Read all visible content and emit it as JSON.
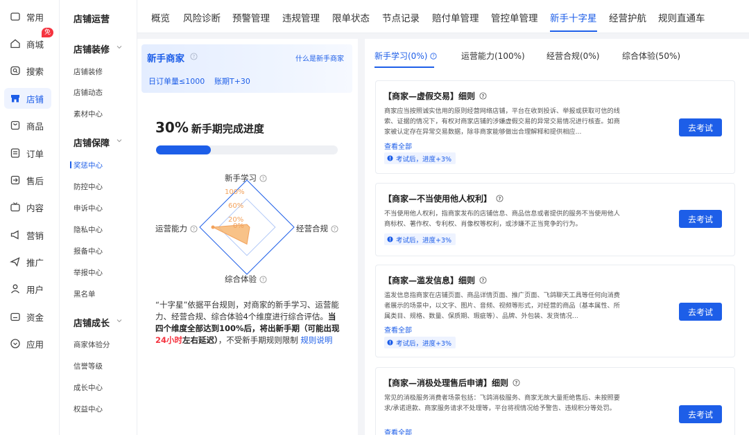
{
  "rail": {
    "items": [
      {
        "label": "常用",
        "icon": "square-icon"
      },
      {
        "label": "商城",
        "icon": "home-icon",
        "badge": "免费"
      },
      {
        "label": "搜索",
        "icon": "search-icon"
      },
      {
        "label": "店铺",
        "icon": "shop-icon"
      },
      {
        "label": "商品",
        "icon": "goods-icon"
      },
      {
        "label": "订单",
        "icon": "order-icon"
      },
      {
        "label": "售后",
        "icon": "aftersale-icon"
      },
      {
        "label": "内容",
        "icon": "tv-icon"
      },
      {
        "label": "营销",
        "icon": "megaphone-icon"
      },
      {
        "label": "推广",
        "icon": "promote-icon"
      },
      {
        "label": "用户",
        "icon": "user-icon"
      },
      {
        "label": "资金",
        "icon": "wallet-icon"
      },
      {
        "label": "应用",
        "icon": "app-icon"
      }
    ],
    "active_index": 3
  },
  "submenu": {
    "header": "店铺运营",
    "groups": [
      {
        "title": "店铺装修",
        "items": [
          "店铺装修",
          "店铺动态",
          "素材中心"
        ]
      },
      {
        "title": "店铺保障",
        "items": [
          "奖惩中心",
          "防控中心",
          "申诉中心",
          "隐私中心",
          "报备中心",
          "举报中心",
          "黑名单"
        ]
      },
      {
        "title": "店铺成长",
        "items": [
          "商家体验分",
          "信誉等级",
          "成长中心",
          "权益中心"
        ]
      }
    ],
    "active_item": "奖惩中心"
  },
  "top_tabs": {
    "items": [
      "概览",
      "风险诊断",
      "预警管理",
      "违规管理",
      "限单状态",
      "节点记录",
      "赔付单管理",
      "管控单管理",
      "新手十字星",
      "经营护航",
      "规则直通车"
    ],
    "active_index": 8
  },
  "merchant": {
    "title": "新手商家",
    "link": "什么是新手商家",
    "tag1": "日订单量≤1000",
    "tag2": "账期T+30"
  },
  "progress": {
    "percent_text": "30%",
    "label": "新手期完成进度",
    "value": 0.3
  },
  "radar": {
    "top": "新手学习",
    "right": "经营合规",
    "bottom": "综合体验",
    "left": "运营能力",
    "ticks": [
      "100%",
      "60%",
      "20%",
      "0%"
    ],
    "values": {
      "新手学习": 0,
      "经营合规": 0,
      "综合体验": 0.5,
      "运营能力": 1.0
    },
    "colors": {
      "grid": "#1d5ee8",
      "fill": "#f6b36a",
      "stroke": "#f2a15b"
    }
  },
  "description": {
    "part1": "“十字星”依据平台规则，对商家的新手学习、运营能力、经营合规、综合体验4个维度进行综合评估。",
    "bold1": "当四个维度全部达到100%后，将出新手期（可能出现",
    "red": "24小时",
    "bold2": "左右延迟）",
    "part2": "，不受新手期规则限制",
    "link": "规则说明"
  },
  "sub_tabs": {
    "items": [
      "新手学习(0%)",
      "运营能力(100%)",
      "经营合规(0%)",
      "综合体验(50%)"
    ],
    "active_index": 0
  },
  "rules": [
    {
      "title": "【商家—虚假交易】细则",
      "body": "商家应当按照诚实信用的原则经营网络店铺，平台在收到投诉、举报或获取可信的线索、证据的情况下，有权对商家店铺的涉嫌虚假交易的异常交易情况进行核查。如商家被认定存在异常交易数据，除非商家能够做出合理解释和提供相应...",
      "more": "查看全部",
      "badge": "考试后，进度+3%",
      "button": "去考试"
    },
    {
      "title": "【商家—不当使用他人权利】",
      "body": "不当使用他人权利，指商家发布的店铺信息、商品信息或者提供的服务不当使用他人商标权、著作权、专利权、肖像权等权利，或涉嫌不正当竞争的行为。",
      "more": "",
      "badge": "考试后，进度+3%",
      "button": "去考试"
    },
    {
      "title": "【商家—滥发信息】细则",
      "body": "滥发信息指商家在店铺页面、商品详情页面、推广页面、飞鸽聊天工具等任何向消费者展示的场景中，以文字、图片、音频、视频等形式，对经营的商品（基本属性、所属类目、规格、数量、保质期、瑕疵等）、品牌、外包装、发货情况...",
      "more": "查看全部",
      "badge": "考试后，进度+3%",
      "button": "去考试"
    },
    {
      "title": "【商家—消极处理售后申请】细则",
      "body": "常见的消极服务消费者场景包括：飞鸽消极服务、商家无故大量拒绝售后、未按照要求/承诺退款、商家服务请求不处理等，平台将视情况给予警告、违规积分等处罚。",
      "more": "查看全部",
      "badge": "",
      "button": "去考试"
    }
  ]
}
